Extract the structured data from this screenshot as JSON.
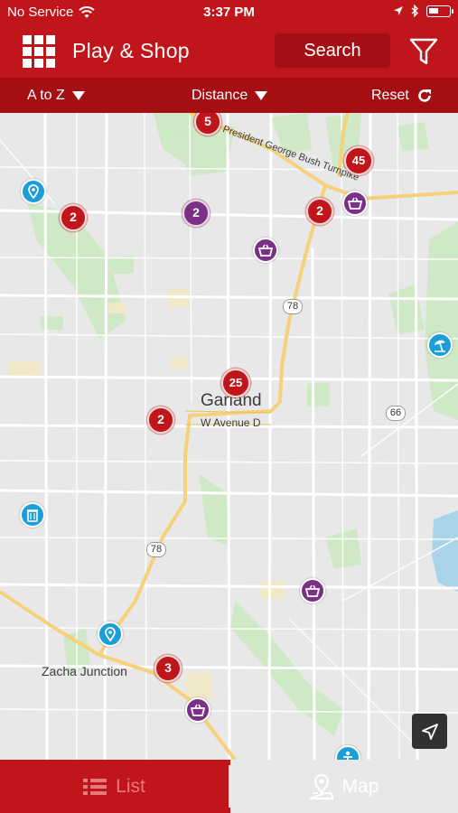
{
  "status_bar": {
    "carrier": "No Service",
    "time": "3:37 PM"
  },
  "header": {
    "title": "Play & Shop",
    "search_label": "Search"
  },
  "sort_bar": {
    "alpha_label": "A to Z",
    "distance_label": "Distance",
    "reset_label": "Reset"
  },
  "map": {
    "labels": {
      "city": "Garland",
      "avenue": "W Avenue D",
      "turnpike": "President George Bush Turnpike",
      "junction": "Zacha Junction"
    },
    "route_shields": [
      "78",
      "66",
      "78"
    ],
    "clusters": [
      "5",
      "45",
      "2",
      "2",
      "2",
      "25",
      "2",
      "3"
    ],
    "pin_icons": [
      "shopping-basket-icon",
      "map-pin-icon",
      "beach-umbrella-icon",
      "trash-can-icon",
      "person-icon"
    ],
    "colors": {
      "cluster": "#c0161b",
      "shop_pin": "#7b2f86",
      "play_pin": "#1b9fd6",
      "park": "#c8e6c0",
      "highway": "#f6d67a"
    }
  },
  "tabbar": {
    "list_label": "List",
    "map_label": "Map"
  },
  "colors": {
    "brand": "#c0161b",
    "brand_dark": "#a50f14"
  }
}
